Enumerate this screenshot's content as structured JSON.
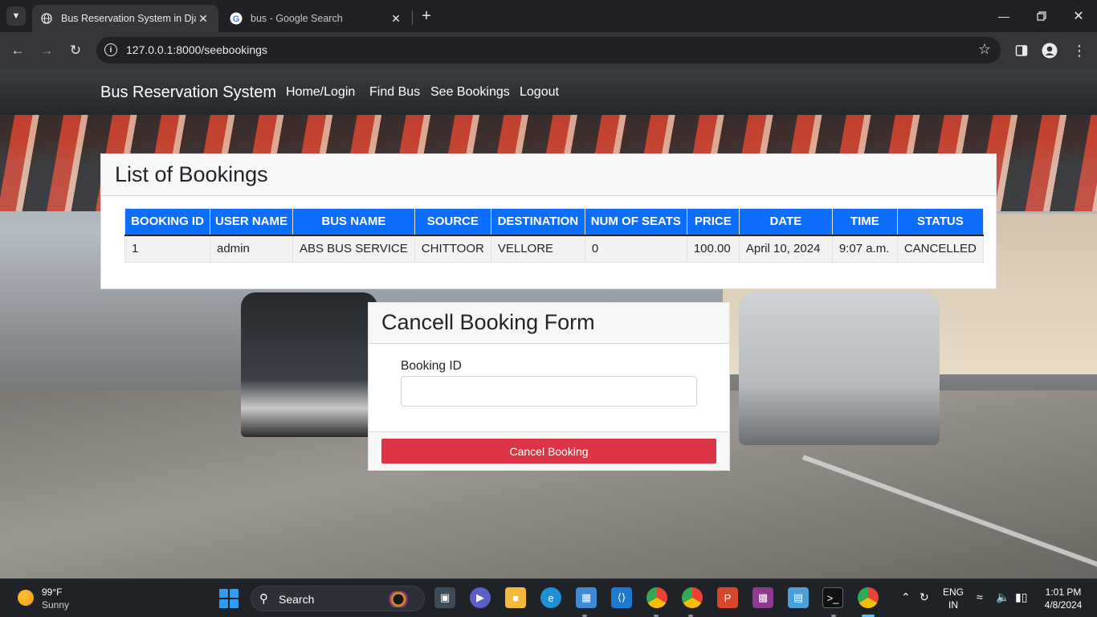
{
  "browser": {
    "tabs": [
      {
        "title": "Bus Reservation System in Djan",
        "active": true
      },
      {
        "title": "bus - Google Search",
        "active": false
      }
    ],
    "url": "127.0.0.1:8000/seebookings"
  },
  "site": {
    "brand": "Bus Reservation System",
    "nav": [
      "Home/Login",
      "Find Bus",
      "See Bookings",
      "Logout"
    ]
  },
  "bookings": {
    "title": "List of Bookings",
    "columns": [
      "BOOKING ID",
      "USER NAME",
      "BUS NAME",
      "SOURCE",
      "DESTINATION",
      "NUM OF SEATS",
      "PRICE",
      "DATE",
      "TIME",
      "STATUS"
    ],
    "rows": [
      [
        "1",
        "admin",
        "ABS BUS SERVICE",
        "CHITTOOR",
        "VELLORE",
        "0",
        "100.00",
        "April 10, 2024",
        "9:07 a.m.",
        "CANCELLED"
      ]
    ]
  },
  "cancel_form": {
    "title": "Cancell Booking Form",
    "label": "Booking ID",
    "value": "",
    "button": "Cancel Booking"
  },
  "taskbar": {
    "weather_temp": "99°F",
    "weather_cond": "Sunny",
    "search_label": "Search",
    "lang": "ENG",
    "region": "IN",
    "time": "1:01 PM",
    "date": "4/8/2024"
  },
  "colors": {
    "primary": "#0d6efd",
    "danger": "#dc3545",
    "navbar": "#2f3236"
  }
}
